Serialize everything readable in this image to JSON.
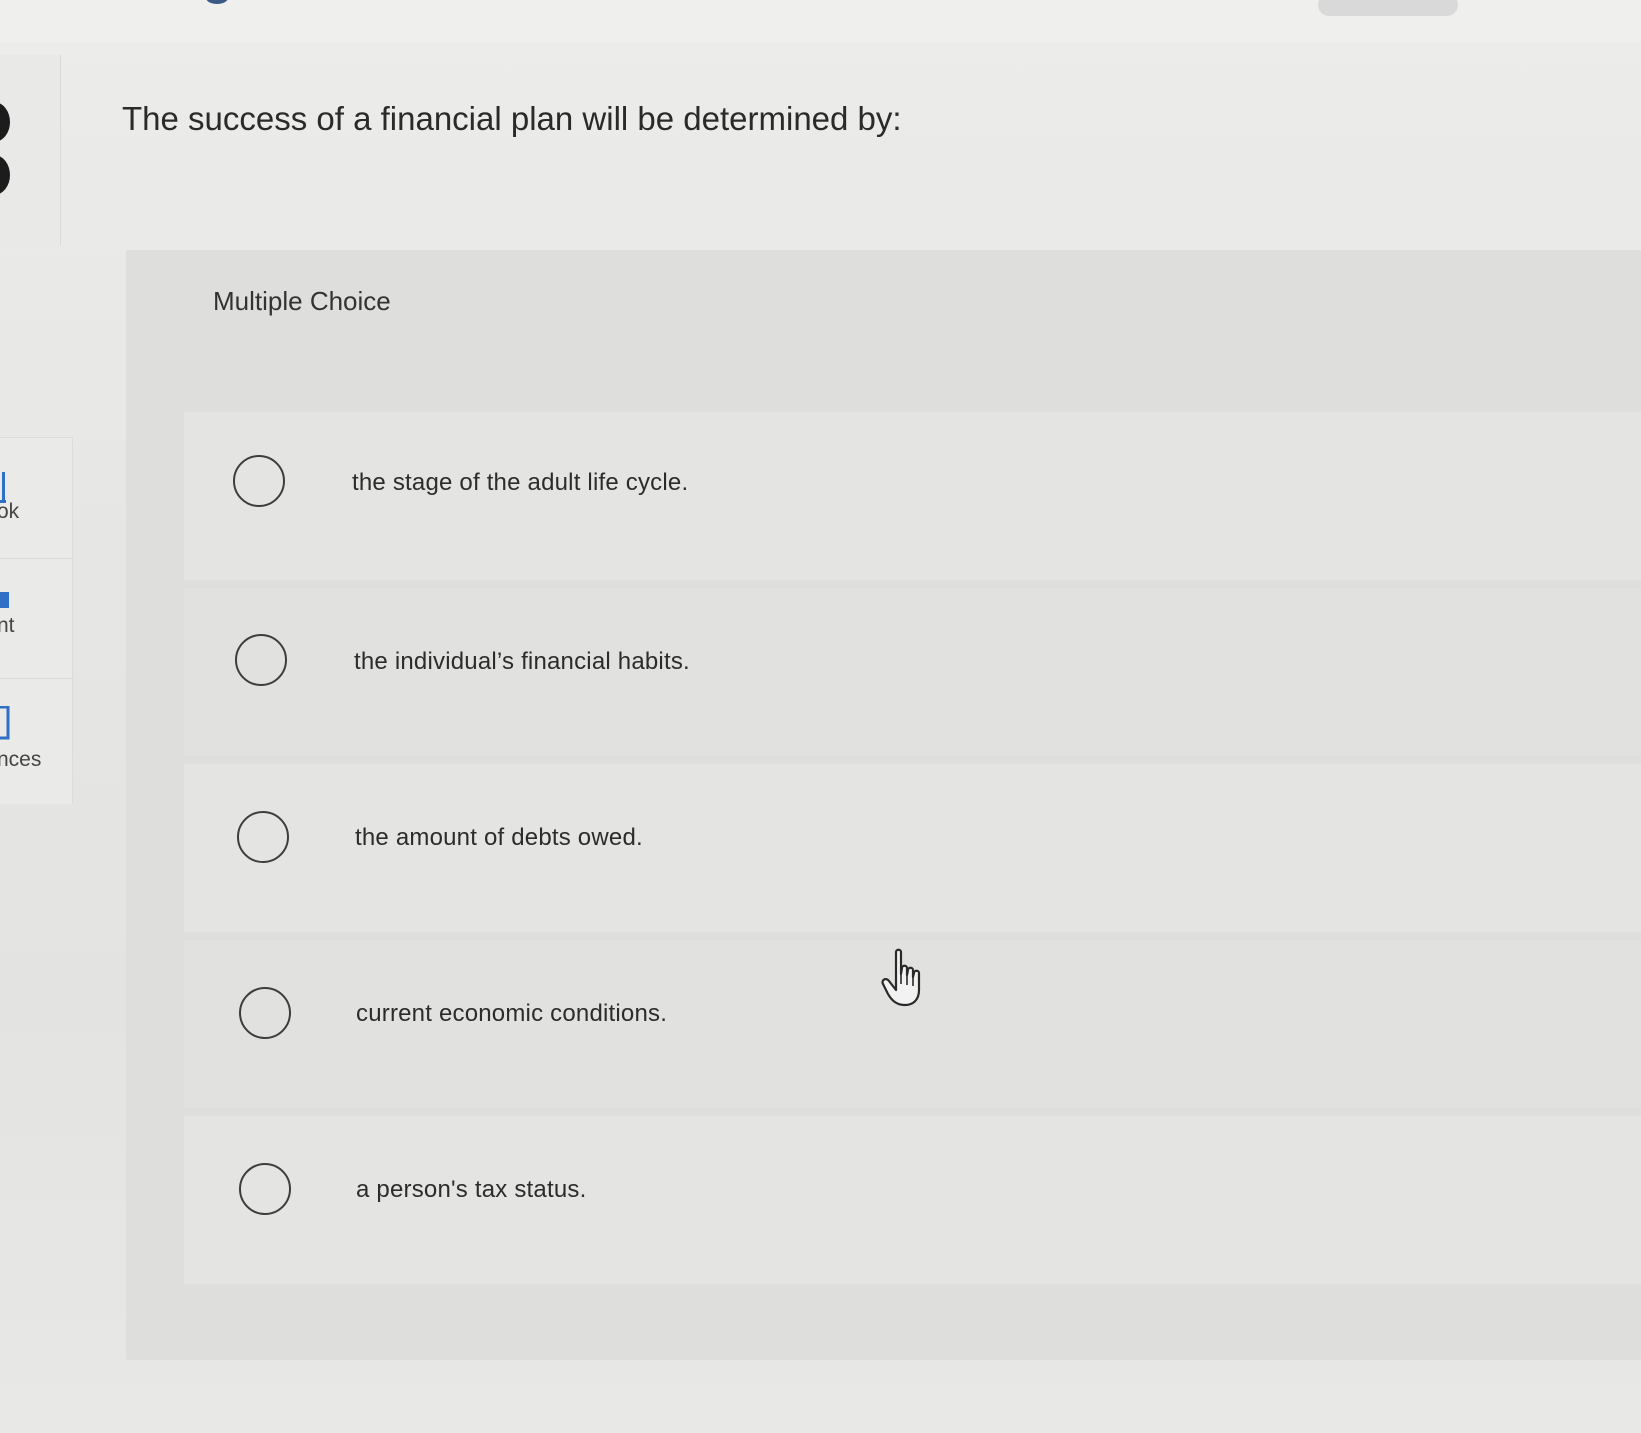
{
  "question": {
    "title": "The success of a financial plan will be determined by:",
    "type_label": "Multiple Choice"
  },
  "sidebar": {
    "items": [
      {
        "label": "ok",
        "icon": "book-icon"
      },
      {
        "label": "nt",
        "icon": "print-icon"
      },
      {
        "label": "nces",
        "icon": "references-icon"
      }
    ]
  },
  "options": [
    {
      "text": "the stage of the adult life cycle.",
      "selected": false
    },
    {
      "text": "the individual’s financial habits.",
      "selected": false
    },
    {
      "text": "the amount of debts owed.",
      "selected": false
    },
    {
      "text": "current economic conditions.",
      "selected": false
    },
    {
      "text": "a person's tax status.",
      "selected": false
    }
  ],
  "colors": {
    "background": "#e6e6e4",
    "panel": "#dededc",
    "accent": "#2f6fc6",
    "text": "#2b2b2b"
  }
}
